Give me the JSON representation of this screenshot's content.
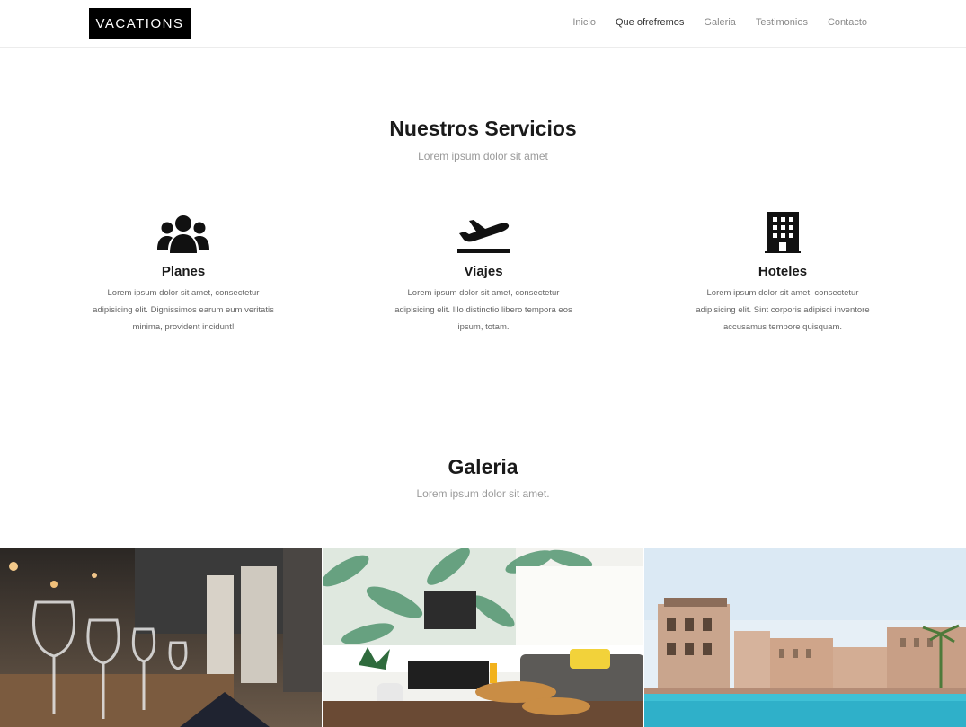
{
  "header": {
    "logo": "VACATIONS",
    "nav": [
      "Inicio",
      "Que ofrefremos",
      "Galeria",
      "Testimonios",
      "Contacto"
    ],
    "active_index": 1
  },
  "services": {
    "title": "Nuestros Servicios",
    "subtitle": "Lorem ipsum dolor sit amet",
    "items": [
      {
        "icon": "users-icon",
        "title": "Planes",
        "text": "Lorem ipsum dolor sit amet, consectetur adipisicing elit. Dignissimos earum eum veritatis minima, provident incidunt!"
      },
      {
        "icon": "plane-departure-icon",
        "title": "Viajes",
        "text": "Lorem ipsum dolor sit amet, consectetur adipisicing elit. Illo distinctio libero tempora eos ipsum, totam."
      },
      {
        "icon": "building-icon",
        "title": "Hoteles",
        "text": "Lorem ipsum dolor sit amet, consectetur adipisicing elit. Sint corporis adipisci inventore accusamus tempore quisquam."
      }
    ]
  },
  "gallery": {
    "title": "Galeria",
    "subtitle": "Lorem ipsum dolor sit amet.",
    "images": [
      "restaurant-photo",
      "living-room-photo",
      "resort-pool-photo"
    ]
  },
  "colors": {
    "text": "#1a1a1a",
    "muted": "#9a9a9a",
    "logo_bg": "#000000"
  }
}
